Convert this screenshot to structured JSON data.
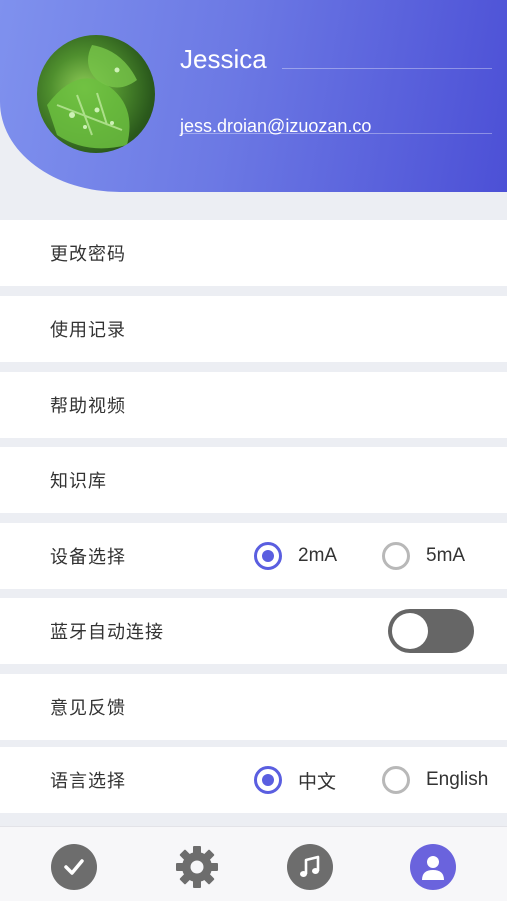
{
  "profile": {
    "name": "Jessica",
    "email": "jess.droian@izuozan.co"
  },
  "menu": {
    "change_password": "更改密码",
    "usage_records": "使用记录",
    "help_video": "帮助视频",
    "knowledge_base": "知识库",
    "device_select": {
      "label": "设备选择",
      "options": [
        "2mA",
        "5mA"
      ],
      "selected": "2mA"
    },
    "bluetooth_auto_connect": {
      "label": "蓝牙自动连接",
      "on": false
    },
    "feedback": "意见反馈",
    "language_select": {
      "label": "语言选择",
      "options": [
        "中文",
        "English"
      ],
      "selected": "中文"
    }
  },
  "tabbar": {
    "icons": [
      "check-icon",
      "gear-icon",
      "music-note-icon",
      "user-icon"
    ],
    "active": "user-icon"
  },
  "colors": {
    "accent": "#5a5ee0",
    "header_start": "#7f91ee",
    "header_end": "#4c50d6",
    "toggle_off": "#666666"
  }
}
